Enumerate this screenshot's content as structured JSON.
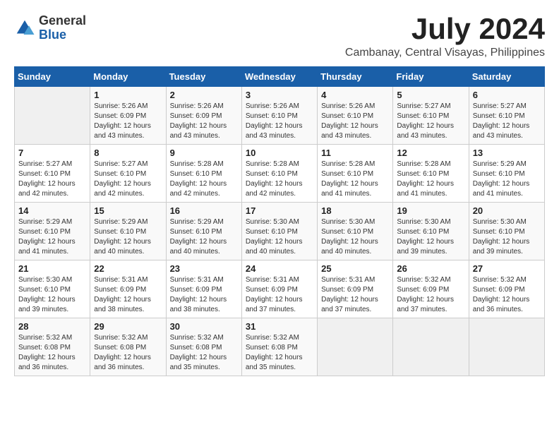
{
  "logo": {
    "general": "General",
    "blue": "Blue"
  },
  "title": "July 2024",
  "location": "Cambanay, Central Visayas, Philippines",
  "headers": [
    "Sunday",
    "Monday",
    "Tuesday",
    "Wednesday",
    "Thursday",
    "Friday",
    "Saturday"
  ],
  "weeks": [
    [
      {
        "day": "",
        "info": ""
      },
      {
        "day": "1",
        "info": "Sunrise: 5:26 AM\nSunset: 6:09 PM\nDaylight: 12 hours\nand 43 minutes."
      },
      {
        "day": "2",
        "info": "Sunrise: 5:26 AM\nSunset: 6:09 PM\nDaylight: 12 hours\nand 43 minutes."
      },
      {
        "day": "3",
        "info": "Sunrise: 5:26 AM\nSunset: 6:10 PM\nDaylight: 12 hours\nand 43 minutes."
      },
      {
        "day": "4",
        "info": "Sunrise: 5:26 AM\nSunset: 6:10 PM\nDaylight: 12 hours\nand 43 minutes."
      },
      {
        "day": "5",
        "info": "Sunrise: 5:27 AM\nSunset: 6:10 PM\nDaylight: 12 hours\nand 43 minutes."
      },
      {
        "day": "6",
        "info": "Sunrise: 5:27 AM\nSunset: 6:10 PM\nDaylight: 12 hours\nand 43 minutes."
      }
    ],
    [
      {
        "day": "7",
        "info": "Sunrise: 5:27 AM\nSunset: 6:10 PM\nDaylight: 12 hours\nand 42 minutes."
      },
      {
        "day": "8",
        "info": "Sunrise: 5:27 AM\nSunset: 6:10 PM\nDaylight: 12 hours\nand 42 minutes."
      },
      {
        "day": "9",
        "info": "Sunrise: 5:28 AM\nSunset: 6:10 PM\nDaylight: 12 hours\nand 42 minutes."
      },
      {
        "day": "10",
        "info": "Sunrise: 5:28 AM\nSunset: 6:10 PM\nDaylight: 12 hours\nand 42 minutes."
      },
      {
        "day": "11",
        "info": "Sunrise: 5:28 AM\nSunset: 6:10 PM\nDaylight: 12 hours\nand 41 minutes."
      },
      {
        "day": "12",
        "info": "Sunrise: 5:28 AM\nSunset: 6:10 PM\nDaylight: 12 hours\nand 41 minutes."
      },
      {
        "day": "13",
        "info": "Sunrise: 5:29 AM\nSunset: 6:10 PM\nDaylight: 12 hours\nand 41 minutes."
      }
    ],
    [
      {
        "day": "14",
        "info": "Sunrise: 5:29 AM\nSunset: 6:10 PM\nDaylight: 12 hours\nand 41 minutes."
      },
      {
        "day": "15",
        "info": "Sunrise: 5:29 AM\nSunset: 6:10 PM\nDaylight: 12 hours\nand 40 minutes."
      },
      {
        "day": "16",
        "info": "Sunrise: 5:29 AM\nSunset: 6:10 PM\nDaylight: 12 hours\nand 40 minutes."
      },
      {
        "day": "17",
        "info": "Sunrise: 5:30 AM\nSunset: 6:10 PM\nDaylight: 12 hours\nand 40 minutes."
      },
      {
        "day": "18",
        "info": "Sunrise: 5:30 AM\nSunset: 6:10 PM\nDaylight: 12 hours\nand 40 minutes."
      },
      {
        "day": "19",
        "info": "Sunrise: 5:30 AM\nSunset: 6:10 PM\nDaylight: 12 hours\nand 39 minutes."
      },
      {
        "day": "20",
        "info": "Sunrise: 5:30 AM\nSunset: 6:10 PM\nDaylight: 12 hours\nand 39 minutes."
      }
    ],
    [
      {
        "day": "21",
        "info": "Sunrise: 5:30 AM\nSunset: 6:10 PM\nDaylight: 12 hours\nand 39 minutes."
      },
      {
        "day": "22",
        "info": "Sunrise: 5:31 AM\nSunset: 6:09 PM\nDaylight: 12 hours\nand 38 minutes."
      },
      {
        "day": "23",
        "info": "Sunrise: 5:31 AM\nSunset: 6:09 PM\nDaylight: 12 hours\nand 38 minutes."
      },
      {
        "day": "24",
        "info": "Sunrise: 5:31 AM\nSunset: 6:09 PM\nDaylight: 12 hours\nand 37 minutes."
      },
      {
        "day": "25",
        "info": "Sunrise: 5:31 AM\nSunset: 6:09 PM\nDaylight: 12 hours\nand 37 minutes."
      },
      {
        "day": "26",
        "info": "Sunrise: 5:32 AM\nSunset: 6:09 PM\nDaylight: 12 hours\nand 37 minutes."
      },
      {
        "day": "27",
        "info": "Sunrise: 5:32 AM\nSunset: 6:09 PM\nDaylight: 12 hours\nand 36 minutes."
      }
    ],
    [
      {
        "day": "28",
        "info": "Sunrise: 5:32 AM\nSunset: 6:08 PM\nDaylight: 12 hours\nand 36 minutes."
      },
      {
        "day": "29",
        "info": "Sunrise: 5:32 AM\nSunset: 6:08 PM\nDaylight: 12 hours\nand 36 minutes."
      },
      {
        "day": "30",
        "info": "Sunrise: 5:32 AM\nSunset: 6:08 PM\nDaylight: 12 hours\nand 35 minutes."
      },
      {
        "day": "31",
        "info": "Sunrise: 5:32 AM\nSunset: 6:08 PM\nDaylight: 12 hours\nand 35 minutes."
      },
      {
        "day": "",
        "info": ""
      },
      {
        "day": "",
        "info": ""
      },
      {
        "day": "",
        "info": ""
      }
    ]
  ]
}
